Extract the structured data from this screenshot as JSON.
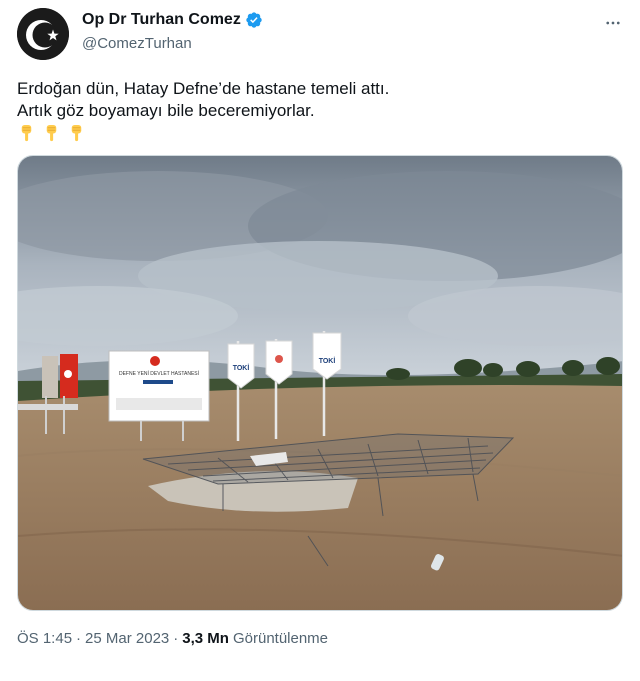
{
  "author": {
    "display_name": "Op Dr Turhan Comez",
    "handle": "@ComezTurhan",
    "verified": true,
    "avatar_icon": "crescent-star-avatar-icon"
  },
  "tweet": {
    "line1": "Erdoğan dün, Hatay Defne’de hastane temeli attı.",
    "line2": "Artık göz boyamayı bile beceremiyorlar.",
    "emoji": [
      "pointing-down-hand",
      "pointing-down-hand",
      "pointing-down-hand"
    ],
    "photo": {
      "billboard_title": "DEFNE YENİ DEVLET HASTANESİ",
      "flag_text": "TOKİ"
    }
  },
  "meta": {
    "time": "ÖS 1:45",
    "separator1": "·",
    "date": "25 Mar 2023",
    "separator2": "·",
    "views_count": "3,3 Mn",
    "views_label": "Görüntülenme"
  },
  "colors": {
    "accent": "#1d9bf0",
    "text_primary": "#0f1419",
    "text_secondary": "#536471",
    "border": "#cfd9de"
  }
}
